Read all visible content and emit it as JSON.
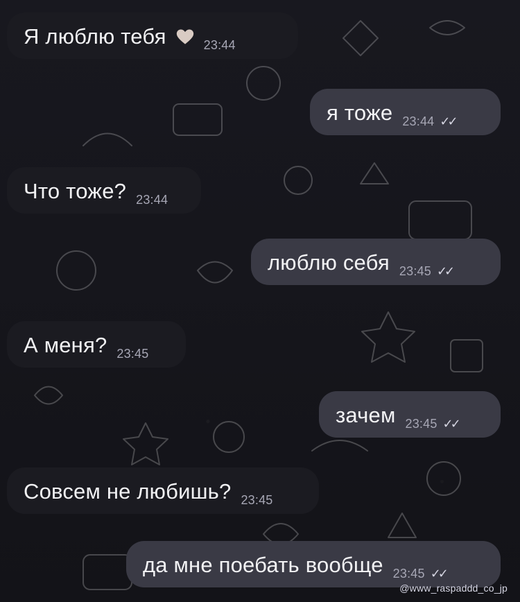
{
  "messages": [
    {
      "direction": "incoming",
      "text": "Я люблю тебя",
      "time": "23:44",
      "emoji": "heart"
    },
    {
      "direction": "outgoing",
      "text": "я тоже",
      "time": "23:44",
      "status": "✓✓"
    },
    {
      "direction": "incoming",
      "text": "Что тоже?",
      "time": "23:44"
    },
    {
      "direction": "outgoing",
      "text": "люблю себя",
      "time": "23:45",
      "status": "✓✓"
    },
    {
      "direction": "incoming",
      "text": "А меня?",
      "time": "23:45"
    },
    {
      "direction": "outgoing",
      "text": "зачем",
      "time": "23:45",
      "status": "✓✓"
    },
    {
      "direction": "incoming",
      "text": "Совсем не любишь?",
      "time": "23:45"
    },
    {
      "direction": "outgoing",
      "text": "да мне поебать вообще",
      "time": "23:45",
      "status": "✓✓"
    }
  ],
  "watermark": "@www_raspaddd_co_jp",
  "colors": {
    "background": "#16161c",
    "incoming_bubble": "#1b1b21",
    "outgoing_bubble": "#3a3a45",
    "text": "#f2f2f4",
    "time": "#a7a7b5"
  }
}
